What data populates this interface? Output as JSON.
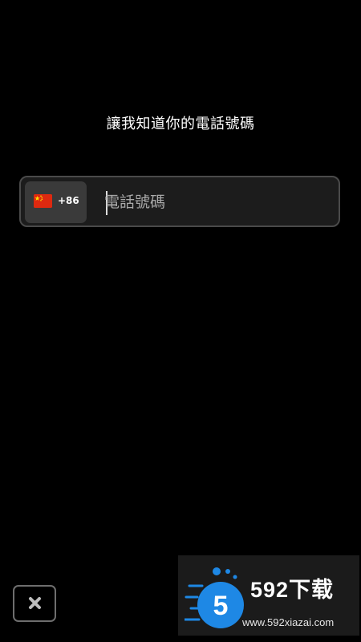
{
  "prompt": {
    "title": "讓我知道你的電話號碼"
  },
  "phone": {
    "country_flag": "china-flag-icon",
    "dial_code": "+86",
    "placeholder": "電話號碼",
    "value": ""
  },
  "actions": {
    "close_icon": "close-icon"
  },
  "watermark": {
    "brand": "592下载",
    "url": "www.592xiazai.com",
    "logo_digit": "5"
  },
  "colors": {
    "background": "#000000",
    "input_bg": "#1c1c1c",
    "input_border": "#4a4a4a",
    "country_bg": "#3a3a3a",
    "flag_red": "#de2910",
    "flag_yellow": "#ffde00",
    "logo_blue": "#1e88e5"
  }
}
